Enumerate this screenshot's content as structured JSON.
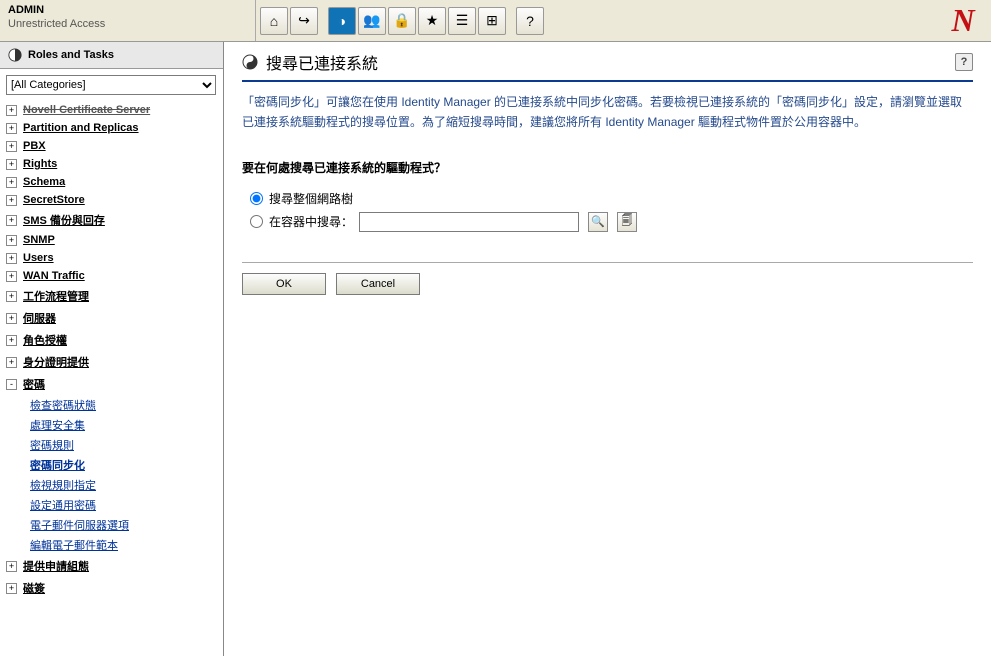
{
  "header": {
    "title": "ADMIN",
    "subtitle": "Unrestricted Access"
  },
  "toolbar": {
    "icons": [
      "home-icon",
      "exit-icon",
      "tag-icon",
      "users-icon",
      "lock-icon",
      "star-icon",
      "list-icon",
      "org-icon",
      "help-icon"
    ]
  },
  "sidebar": {
    "header": "Roles and Tasks",
    "category_selected": "[All Categories]",
    "items": [
      {
        "label": "Novell Certificate Server",
        "exp": "+",
        "strike": true
      },
      {
        "label": "Partition and Replicas",
        "exp": "+"
      },
      {
        "label": "PBX",
        "exp": "+"
      },
      {
        "label": "Rights",
        "exp": "+"
      },
      {
        "label": "Schema",
        "exp": "+"
      },
      {
        "label": "SecretStore",
        "exp": "+"
      },
      {
        "label": "SMS 備份與回存",
        "exp": "+"
      },
      {
        "label": "SNMP",
        "exp": "+"
      },
      {
        "label": "Users",
        "exp": "+"
      },
      {
        "label": "WAN Traffic",
        "exp": "+"
      },
      {
        "label": "工作流程管理",
        "exp": "+"
      },
      {
        "label": "伺服器",
        "exp": "+"
      },
      {
        "label": "角色授權",
        "exp": "+"
      },
      {
        "label": "身分證明提供",
        "exp": "+"
      },
      {
        "label": "密碼",
        "exp": "-",
        "open": true
      },
      {
        "label": "提供申請組態",
        "exp": "+"
      },
      {
        "label": "磁簽",
        "exp": "+"
      }
    ],
    "password_sub": [
      {
        "label": "檢查密碼狀態"
      },
      {
        "label": "處理安全集"
      },
      {
        "label": "密碼規則"
      },
      {
        "label": "密碼同步化",
        "active": true
      },
      {
        "label": "檢視規則指定"
      },
      {
        "label": "設定通用密碼"
      },
      {
        "label": "電子郵件伺服器選項"
      },
      {
        "label": "編輯電子郵件範本"
      }
    ]
  },
  "page": {
    "title": "搜尋已連接系統",
    "intro": "「密碼同步化」可讓您在使用 Identity Manager 的已連接系統中同步化密碼。若要檢視已連接系統的「密碼同步化」設定，請瀏覽並選取已連接系統驅動程式的搜尋位置。為了縮短搜尋時間，建議您將所有 Identity Manager 驅動程式物件置於公用容器中。",
    "question": "要在何處搜尋已連接系統的驅動程式？",
    "opt_tree": "搜尋整個網路樹",
    "opt_container": "在容器中搜尋：",
    "ok": "OK",
    "cancel": "Cancel",
    "help": "?"
  }
}
